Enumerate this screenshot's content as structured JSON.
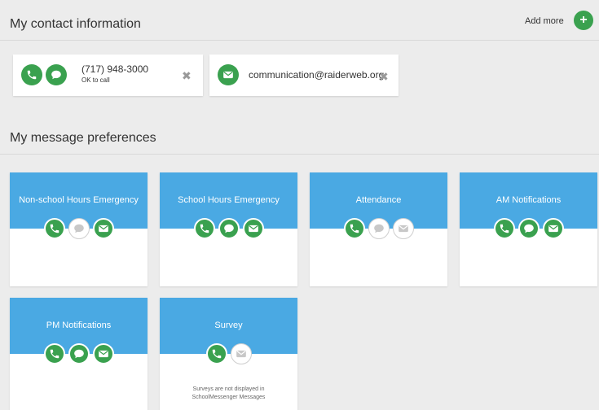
{
  "contact_section": {
    "title": "My contact information",
    "add_more_label": "Add more",
    "add_icon": "+",
    "phone": {
      "number": "(717) 948-3000",
      "status": "OK to call"
    },
    "email": {
      "address": "communication@raiderweb.org"
    },
    "remove_icon": "✖"
  },
  "preferences_section": {
    "title": "My message preferences",
    "cards": [
      {
        "label": "Non-school Hours Emergency",
        "phone": "on",
        "sms": "off",
        "email": "on"
      },
      {
        "label": "School Hours Emergency",
        "phone": "on",
        "sms": "on",
        "email": "on"
      },
      {
        "label": "Attendance",
        "phone": "on",
        "sms": "off",
        "email": "off"
      },
      {
        "label": "AM Notifications",
        "phone": "on",
        "sms": "on",
        "email": "on"
      },
      {
        "label": "PM Notifications",
        "phone": "on",
        "sms": "on",
        "email": "on"
      },
      {
        "label": "Survey",
        "phone": "on",
        "email": "off",
        "note_line1": "Surveys are not displayed in",
        "note_line2": "SchoolMessenger Messages"
      }
    ]
  },
  "colors": {
    "accent_green": "#3aa14f",
    "header_blue": "#4aa9e3",
    "background": "#ececec"
  }
}
